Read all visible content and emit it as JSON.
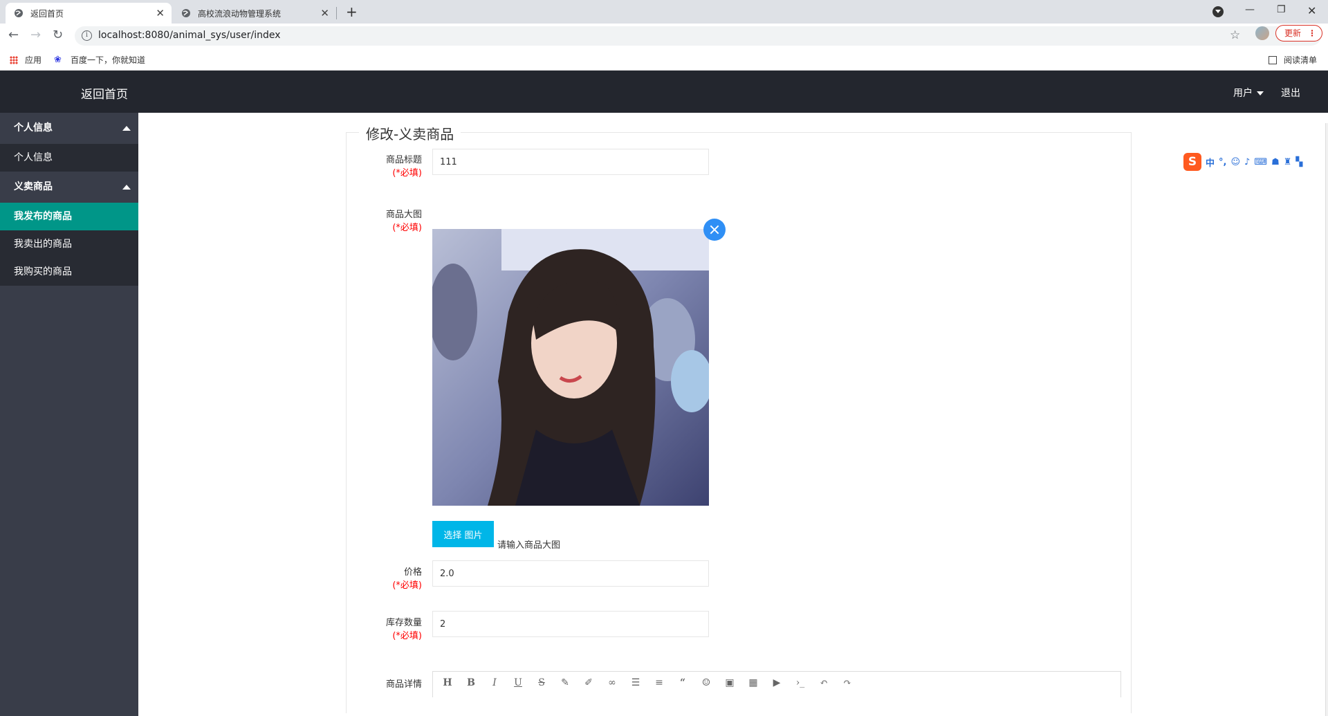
{
  "browser": {
    "tabs": [
      {
        "label": "返回首页",
        "active": true
      },
      {
        "label": "高校流浪动物管理系统",
        "active": false
      }
    ],
    "url": "localhost:8080/animal_sys/user/index",
    "update_label": "更新",
    "bookmarks": [
      {
        "label": "应用",
        "icon": "apps-grid-icon"
      },
      {
        "label": "百度一下，你就知道",
        "icon": "baidu-paw-icon"
      }
    ],
    "reading_list": "阅读清单"
  },
  "app": {
    "brand": "返回首页",
    "nav_user": "用户",
    "nav_logout": "退出"
  },
  "sidebar": {
    "groups": [
      {
        "label": "个人信息",
        "items": [
          {
            "label": "个人信息",
            "active": false
          }
        ]
      },
      {
        "label": "义卖商品",
        "items": [
          {
            "label": "我发布的商品",
            "active": true
          },
          {
            "label": "我卖出的商品",
            "active": false
          },
          {
            "label": "我购买的商品",
            "active": false
          }
        ]
      }
    ]
  },
  "form": {
    "legend": "修改-义卖商品",
    "required_mark": "(*必填)",
    "title": {
      "label": "商品标题",
      "value": "111"
    },
    "image": {
      "label": "商品大图",
      "button": "选择 图片",
      "hint": "请输入商品大图"
    },
    "price": {
      "label": "价格",
      "value": "2.0"
    },
    "stock": {
      "label": "库存数量",
      "value": "2"
    },
    "detail": {
      "label": "商品详情"
    }
  },
  "editor_toolbar": [
    "H",
    "B",
    "I",
    "U",
    "S",
    "pencil",
    "brush",
    "link",
    "list-ul",
    "align",
    "quote",
    "smile",
    "image",
    "table",
    "video",
    "code",
    "undo",
    "redo"
  ],
  "ime": {
    "badge": "S",
    "mode": "中"
  },
  "colors": {
    "nav_bg": "#23262e",
    "sidebar_bg": "#393d49",
    "active_item": "#009688",
    "upload_btn": "#00b6e8",
    "required": "#ff0000"
  }
}
